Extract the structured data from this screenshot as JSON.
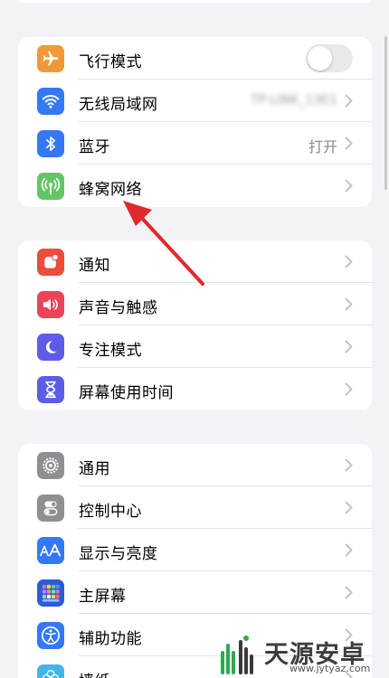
{
  "groups": [
    {
      "name": "connectivity",
      "rows": [
        {
          "label": "飞行模式",
          "icon": "airplane-icon",
          "color": "#f09a37",
          "control": "toggle",
          "toggle_on": false
        },
        {
          "label": "无线局域网",
          "icon": "wifi-icon",
          "color": "#3478f6",
          "value": "TP-LINK_13E1",
          "value_blurred": true
        },
        {
          "label": "蓝牙",
          "icon": "bluetooth-icon",
          "color": "#3478f6",
          "value": "打开"
        },
        {
          "label": "蜂窝网络",
          "icon": "cellular-icon",
          "color": "#65c466"
        }
      ]
    },
    {
      "name": "notifications",
      "rows": [
        {
          "label": "通知",
          "icon": "notification-bell-icon",
          "color": "#eb4d3d"
        },
        {
          "label": "声音与触感",
          "icon": "speaker-icon",
          "color": "#eb445a"
        },
        {
          "label": "专注模式",
          "icon": "moon-icon",
          "color": "#5e5ce6"
        },
        {
          "label": "屏幕使用时间",
          "icon": "hourglass-icon",
          "color": "#5e5ce6"
        }
      ]
    },
    {
      "name": "general",
      "rows": [
        {
          "label": "通用",
          "icon": "gear-icon",
          "color": "#8e8e93"
        },
        {
          "label": "控制中心",
          "icon": "toggles-icon",
          "color": "#8e8e93"
        },
        {
          "label": "显示与亮度",
          "icon": "text-size-icon",
          "color": "#3478f6"
        },
        {
          "label": "主屏幕",
          "icon": "home-grid-icon",
          "color": "#2c5bd8"
        },
        {
          "label": "辅助功能",
          "icon": "accessibility-icon",
          "color": "#3478f6"
        },
        {
          "label": "墙纸",
          "icon": "wallpaper-flower-icon",
          "color": "#45b5e8"
        }
      ]
    }
  ],
  "watermark": {
    "text": "天源安卓网",
    "url": "www.jytyaz.com"
  },
  "annotation": {
    "arrow_color": "#e0282e",
    "points_to": "蜂窝网络"
  }
}
